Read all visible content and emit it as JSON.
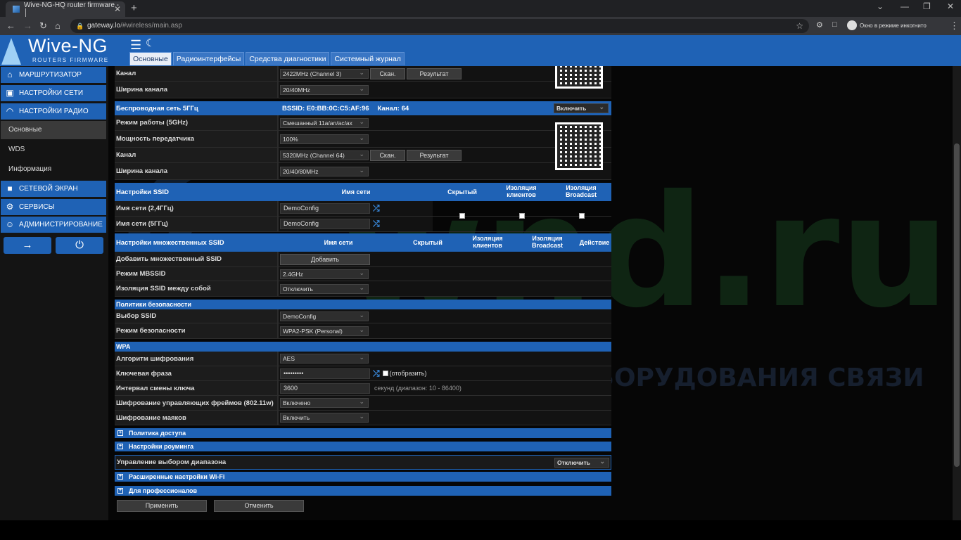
{
  "browser": {
    "tab_title": "Wive-NG-HQ router firmware - │",
    "tab_close": "✕",
    "new_tab": "+",
    "url_host": "gateway.lo",
    "url_path": "/#wireless/main.asp",
    "incognito": "Окно в режиме инкогнито",
    "nav": {
      "back": "←",
      "forward": "→",
      "reload": "↻",
      "home": "⌂",
      "star": "☆",
      "ext": "⚙",
      "side": "□",
      "menu": "⋮",
      "lock": "🔒"
    },
    "win": {
      "chevron": "⌄",
      "min": "—",
      "max": "❐",
      "close": "✕"
    }
  },
  "brand": {
    "name": "Wive-NG",
    "sub": "ROUTERS FIRMWARE"
  },
  "header": {
    "hamburger": "☰",
    "moon": "☾",
    "tabs": [
      "Основные",
      "Радиоинтерфейсы",
      "Средства диагностики",
      "Системный журнал"
    ]
  },
  "sidebar": {
    "router": "МАРШРУТИЗАТОР",
    "network": "НАСТРОЙКИ СЕТИ",
    "radio": "НАСТРОЙКИ РАДИО",
    "sub_basic": "Основные",
    "sub_wds": "WDS",
    "sub_info": "Информация",
    "firewall": "СЕТЕВОЙ ЭКРАН",
    "services": "СЕРВИСЫ",
    "admin": "АДМИНИСТРИРОВАНИЕ",
    "icons": {
      "router": "⌂",
      "network": "▣",
      "radio": "◠",
      "firewall": "■",
      "services": "⚙",
      "admin": "☺",
      "logout": "→",
      "power": "⏻"
    }
  },
  "form": {
    "chan24_label": "Канал",
    "chan24_value": "2422MHz (Channel 3)",
    "scan": "Скан.",
    "result": "Результат",
    "width24_label": "Ширина канала",
    "width24_value": "20/40MHz",
    "net5_label": "Беспроводная сеть 5ГГц",
    "net5_bssid": "BSSID: E0:BB:0C:C5:AF:96",
    "net5_channel": "Канал: 64",
    "net5_enable": "Включить",
    "mode5_label": "Режим работы (5GHz)",
    "mode5_value": "Смешанный 11a/an/ac/ax",
    "power_label": "Мощность передатчика",
    "power_value": "100%",
    "chan5_label": "Канал",
    "chan5_value": "5320MHz (Channel 64)",
    "width5_label": "Ширина канала",
    "width5_value": "20/40/80MHz",
    "ssid_hdr": "Настройки SSID",
    "col_name": "Имя сети",
    "col_hidden": "Скрытый",
    "col_isolation": "Изоляция клиентов",
    "col_bcast": "Изоляция Broadcast",
    "ssid24_label": "Имя сети (2,4ГГц)",
    "ssid24_value": "DemoConfig",
    "ssid5_label": "Имя сети (5ГГц)",
    "ssid5_value": "DemoConfig",
    "shuffle_icon": "⤮",
    "mssid_hdr": "Настройки множественных SSID",
    "col_action": "Действие",
    "add_mssid_label": "Добавить множественный SSID",
    "add_btn": "Добавить",
    "mbssid_mode_label": "Режим MBSSID",
    "mbssid_mode_value": "2.4GHz",
    "ssid_iso_label": "Изоляция SSID между собой",
    "ssid_iso_value": "Отключить",
    "sec_hdr": "Политики безопасности",
    "ssid_sel_label": "Выбор SSID",
    "ssid_sel_value": "DemoConfig",
    "sec_mode_label": "Режим безопасности",
    "sec_mode_value": "WPA2-PSK (Personal)",
    "wpa_hdr": "WPA",
    "cipher_label": "Алгоритм шифрования",
    "cipher_value": "AES",
    "key_label": "Ключевая фраза",
    "key_value": "•••••••••",
    "show": "(отобразить)",
    "rekey_label": "Интервал смены ключа",
    "rekey_value": "3600",
    "rekey_hint": "секунд (диапазон: 10 - 86400)",
    "pmf_label": "Шифрование управляющих фреймов (802.11w)",
    "pmf_value": "Включено",
    "beacon_label": "Шифрование маяков",
    "beacon_value": "Включить",
    "access_policy": "Политика доступа",
    "roaming": "Настройки роуминга",
    "band_steer_label": "Управление выбором диапазона",
    "band_steer_value": "Отключить",
    "advanced": "Расширенные настройки Wi-Fi",
    "pro": "Для профессионалов",
    "plus": "+",
    "apply": "Применить",
    "cancel": "Отменить"
  },
  "watermark": {
    "logo": "wifi-logo",
    "site": "wnd.ru",
    "tagline": "ДИСТРИБЬЮТОР ОБОРУДОВАНИЯ СВЯЗИ"
  },
  "colors": {
    "accent": "#1f62b5",
    "bg": "#060606"
  }
}
